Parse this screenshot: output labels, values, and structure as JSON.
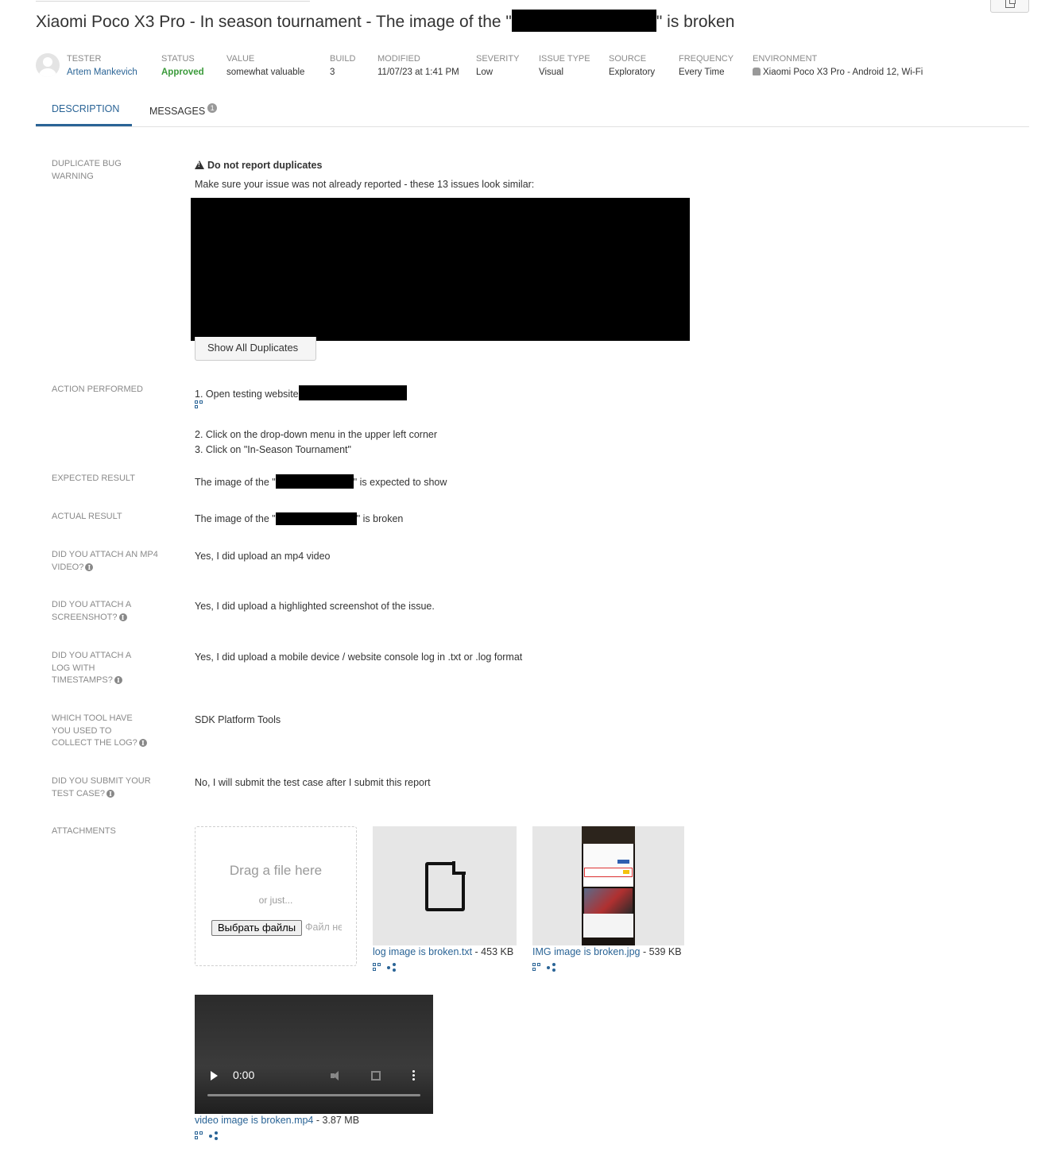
{
  "title": {
    "prefix": "Xiaomi Poco X3 Pro - In season tournament - The image of the \"",
    "suffix": "\" is broken"
  },
  "meta": [
    {
      "label": "TESTER",
      "value": "Artem Mankevich"
    },
    {
      "label": "STATUS",
      "value": "Approved"
    },
    {
      "label": "VALUE",
      "value": "somewhat valuable"
    },
    {
      "label": "BUILD",
      "value": "3"
    },
    {
      "label": "MODIFIED",
      "value": "11/07/23 at 1:41 PM"
    },
    {
      "label": "SEVERITY",
      "value": "Low"
    },
    {
      "label": "ISSUE TYPE",
      "value": "Visual"
    },
    {
      "label": "SOURCE",
      "value": "Exploratory"
    },
    {
      "label": "FREQUENCY",
      "value": "Every Time"
    },
    {
      "label": "ENVIRONMENT",
      "value": "Xiaomi Poco X3 Pro - Android 12, Wi-Fi"
    }
  ],
  "tabs": {
    "description": "DESCRIPTION",
    "messages": "MESSAGES",
    "messages_count": "1"
  },
  "duplicate": {
    "label": "DUPLICATE BUG WARNING",
    "heading": "Do not report duplicates",
    "text": "Make sure your issue was not already reported - these 13 issues look similar:",
    "button": "Show All Duplicates"
  },
  "action": {
    "label": "ACTION PERFORMED",
    "step1": "1. Open testing website",
    "step2": "2. Click on the drop-down menu in the upper left corner",
    "step3": "3. Click on \"In-Season Tournament\""
  },
  "expected": {
    "label": "EXPECTED RESULT",
    "prefix": "The image of the \"",
    "suffix": "\" is expected to show"
  },
  "actual": {
    "label": "ACTUAL RESULT",
    "prefix": "The image of the \"",
    "suffix": "\" is broken"
  },
  "questions": [
    {
      "label": "DID YOU ATTACH AN MP4 VIDEO?",
      "answer": "Yes, I did upload an mp4 video"
    },
    {
      "label": "DID YOU ATTACH A SCREENSHOT?",
      "answer": "Yes, I did upload a highlighted screenshot of the issue."
    },
    {
      "label": "DID YOU ATTACH A LOG WITH TIMESTAMPS?",
      "answer": "Yes, I did upload a mobile device / website console log in .txt or .log format"
    },
    {
      "label": "WHICH TOOL HAVE YOU USED TO COLLECT THE LOG?",
      "answer": "SDK Platform Tools"
    },
    {
      "label": "DID YOU SUBMIT YOUR TEST CASE?",
      "answer": "No, I will submit the test case after I submit this report"
    }
  ],
  "attachments": {
    "label": "ATTACHMENTS",
    "dropzone_title": "Drag a file here",
    "dropzone_sub": "or just...",
    "choose_button": "Выбрать файлы",
    "no_file": "Файл не выбран",
    "files": [
      {
        "name": "log image is broken.txt",
        "size": " - 453 KB",
        "icon": "file-icon"
      },
      {
        "name": "IMG image is broken.jpg",
        "size": " - 539 KB",
        "icon": "image-thumbnail"
      },
      {
        "name": "video image is broken.mp4",
        "size": " - 3.87 MB",
        "icon": "video-player"
      }
    ],
    "video_time": "0:00"
  }
}
